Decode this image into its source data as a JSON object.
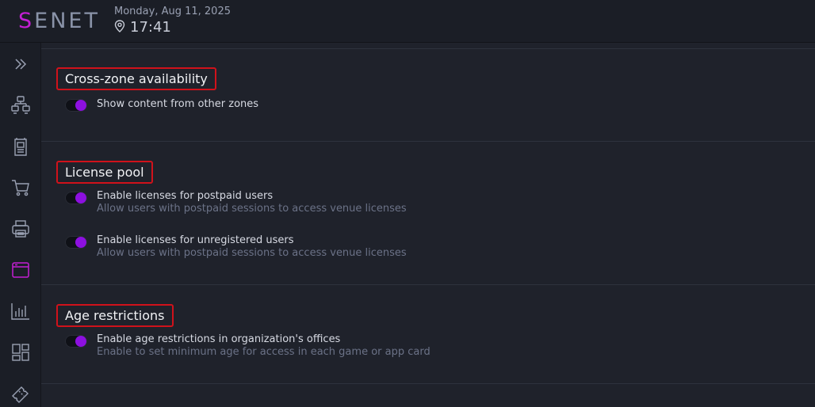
{
  "header": {
    "logo_first": "S",
    "logo_rest": "ENET",
    "date": "Monday, Aug 11, 2025",
    "time": "17:41"
  },
  "sidebar": {
    "items": [
      {
        "icon": "expand-chevrons-icon"
      },
      {
        "icon": "network-icon"
      },
      {
        "icon": "vending-machine-icon"
      },
      {
        "icon": "cart-icon"
      },
      {
        "icon": "printer-icon"
      },
      {
        "icon": "browser-window-icon",
        "active": true
      },
      {
        "icon": "bar-chart-icon"
      },
      {
        "icon": "dashboard-grid-icon"
      },
      {
        "icon": "ticket-icon"
      }
    ]
  },
  "sections": {
    "cross_zone": {
      "title": "Cross-zone availability",
      "options": [
        {
          "label": "Show content from other zones",
          "desc": ""
        }
      ]
    },
    "license_pool": {
      "title": "License pool",
      "options": [
        {
          "label": "Enable licenses for postpaid users",
          "desc": "Allow users with postpaid sessions to access venue licenses"
        },
        {
          "label": "Enable licenses for unregistered users",
          "desc": "Allow users with postpaid sessions to access venue licenses"
        }
      ]
    },
    "age": {
      "title": "Age restrictions",
      "options": [
        {
          "label": "Enable age restrictions in organization's offices",
          "desc": "Enable to set minimum age for access in each game or app card"
        }
      ]
    }
  },
  "colors": {
    "accent": "#8d10e0",
    "logo_accent": "#c41fd4",
    "highlight_border": "#d0121b",
    "background": "#1f222b"
  }
}
